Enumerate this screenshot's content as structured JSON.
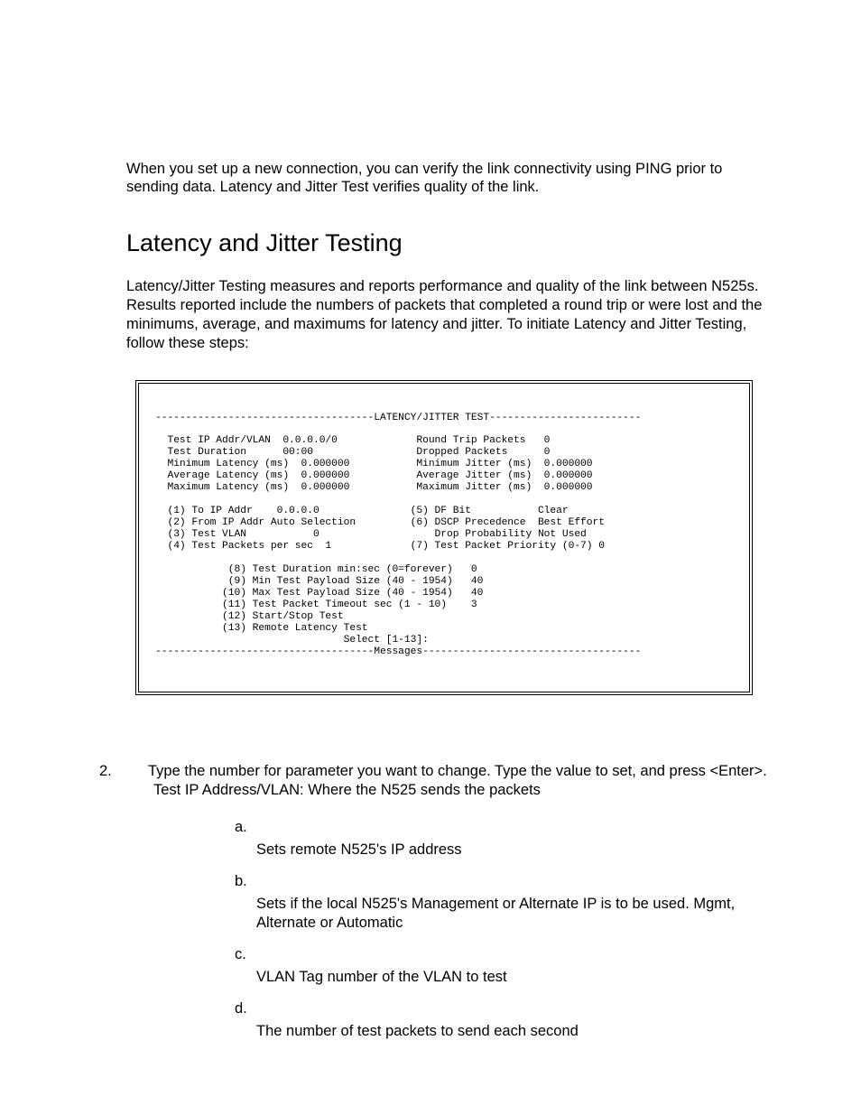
{
  "intro": "When you set up a new connection, you can verify the link connectivity using PING prior to sending data.   Latency and Jitter Test verifies quality of the link.",
  "section_title": "Latency and Jitter Testing",
  "section_body": "Latency/Jitter Testing measures and reports performance and quality of the link between N525s.  Results reported include the numbers of packets that completed a round trip or were lost and the minimums, average, and maximums for latency and jitter.  To initiate Latency and Jitter Testing, follow these steps:",
  "terminal_text": "------------------------------------LATENCY/JITTER TEST-------------------------\n\n  Test IP Addr/VLAN  0.0.0.0/0             Round Trip Packets   0\n  Test Duration      00:00                 Dropped Packets      0\n  Minimum Latency (ms)  0.000000           Minimum Jitter (ms)  0.000000\n  Average Latency (ms)  0.000000           Average Jitter (ms)  0.000000\n  Maximum Latency (ms)  0.000000           Maximum Jitter (ms)  0.000000\n\n  (1) To IP Addr    0.0.0.0               (5) DF Bit           Clear\n  (2) From IP Addr Auto Selection         (6) DSCP Precedence  Best Effort\n  (3) Test VLAN           0                   Drop Probability Not Used\n  (4) Test Packets per sec  1             (7) Test Packet Priority (0-7) 0\n\n            (8) Test Duration min:sec (0=forever)   0\n            (9) Min Test Payload Size (40 - 1954)   40\n           (10) Max Test Payload Size (40 - 1954)   40\n           (11) Test Packet Timeout sec (1 - 10)    3\n           (12) Start/Stop Test\n           (13) Remote Latency Test\n                               Select [1-13]:\n------------------------------------Messages------------------------------------",
  "step": {
    "num": "2.",
    "body": "Type the number for parameter you want to change.  Type the value to set, and press <Enter>.  Test IP Address/VLAN:  Where the N525 sends the packets"
  },
  "subitems": {
    "a": {
      "letter": "a.",
      "desc": "Sets remote N525's IP address"
    },
    "b": {
      "letter": "b.",
      "desc": "Sets if the local N525's Management or Alternate IP is to be used.  Mgmt, Alternate or Automatic"
    },
    "c": {
      "letter": "c.",
      "desc": "VLAN Tag number of the VLAN to test"
    },
    "d": {
      "letter": "d.",
      "desc": "The number of test packets to send each second"
    }
  }
}
